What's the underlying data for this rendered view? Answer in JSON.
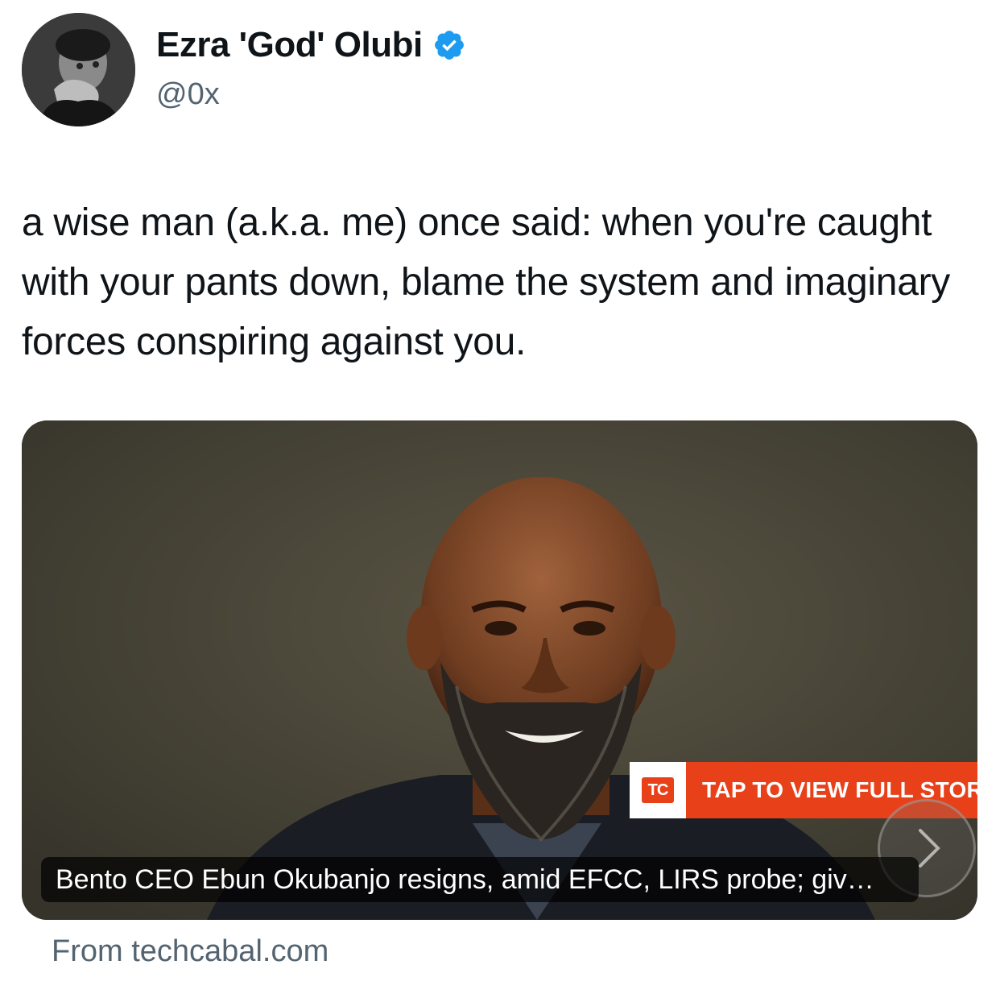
{
  "author": {
    "display_name": "Ezra 'God' Olubi",
    "handle": "@0x",
    "verified": true,
    "avatar_icon": "person-avatar"
  },
  "tweet": {
    "text": "a wise man (a.k.a. me) once said: when you're caught with your pants down, blame the system and imaginary forces conspiring against you."
  },
  "card": {
    "image_icon": "bearded-man-portrait",
    "banner_logo": "TC",
    "banner_text": "TAP TO VIEW FULL STORY",
    "caption": "Bento CEO Ebun Okubanjo resigns, amid EFCC, LIRS probe; giv…",
    "next_icon": "chevron-right-icon",
    "source": "From techcabal.com"
  },
  "colors": {
    "verified_blue": "#1d9bf0",
    "banner_red": "#e8411a",
    "secondary_text": "#536471",
    "primary_text": "#0f1419"
  }
}
